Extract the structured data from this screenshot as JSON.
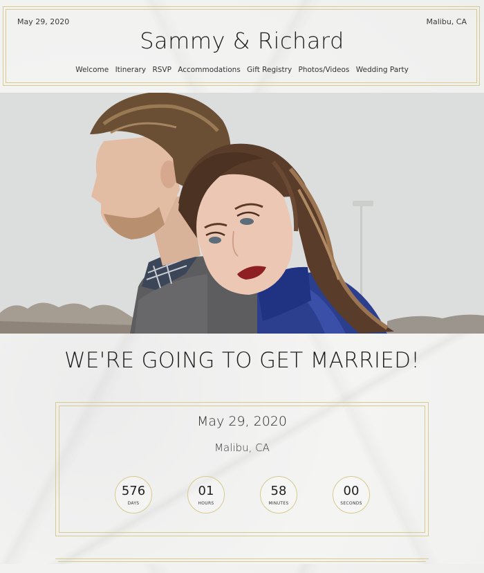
{
  "header": {
    "date": "May 29, 2020",
    "location": "Malibu, CA",
    "title": "Sammy & Richard",
    "nav": [
      "Welcome",
      "Itinerary",
      "RSVP",
      "Accommodations",
      "Gift Registry",
      "Photos/Videos",
      "Wedding Party"
    ]
  },
  "hero": {
    "image": "couple-photo"
  },
  "announcement": {
    "headline": "WE'RE GOING TO GET MARRIED!"
  },
  "event": {
    "date": "May 29, 2020",
    "location": "Malibu, CA"
  },
  "countdown": [
    {
      "value": "576",
      "label": "DAYS"
    },
    {
      "value": "01",
      "label": "HOURS"
    },
    {
      "value": "58",
      "label": "MINUTES"
    },
    {
      "value": "00",
      "label": "SECONDS"
    }
  ],
  "colors": {
    "accent_gold": "#d8c98c",
    "text": "#1e1e1e",
    "background": "#f1f1f0"
  }
}
